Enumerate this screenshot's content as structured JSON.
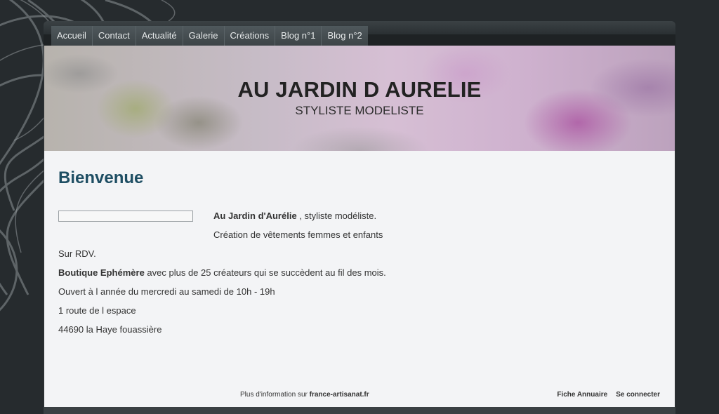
{
  "nav": {
    "items": [
      {
        "label": "Accueil"
      },
      {
        "label": "Contact"
      },
      {
        "label": "Actualité"
      },
      {
        "label": "Galerie"
      },
      {
        "label": "Créations"
      },
      {
        "label": "Blog n°1"
      },
      {
        "label": "Blog n°2"
      }
    ]
  },
  "header": {
    "title": "AU JARDIN D AURELIE",
    "subtitle": "STYLISTE MODELISTE"
  },
  "content": {
    "title": "Bienvenue",
    "intro_bold": "Au Jardin d'Aurélie",
    "intro_rest": " , styliste modéliste.",
    "creation": "Création de vêtements femmes et enfants",
    "rdv": "Sur RDV.",
    "boutique_bold": "Boutique Ephémère",
    "boutique_rest": " avec plus de 25 créateurs qui se succèdent au fil des mois.",
    "hours": "Ouvert à l année du mercredi au samedi de 10h - 19h",
    "address": "1 route de l espace",
    "city": "44690 la Haye fouassière"
  },
  "footer": {
    "info_prefix": "Plus d'information sur ",
    "info_link": "france-artisanat.fr",
    "directory_link": "Fiche Annuaire",
    "login_link": "Se connecter"
  }
}
